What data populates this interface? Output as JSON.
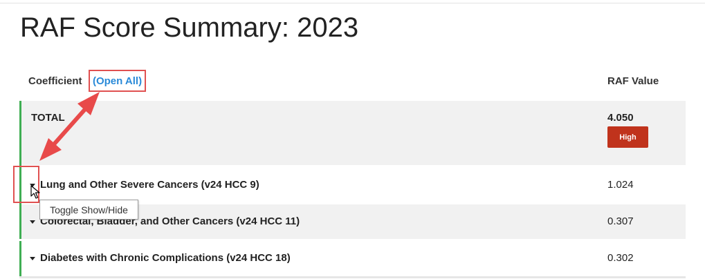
{
  "page": {
    "title": "RAF Score Summary: 2023"
  },
  "table": {
    "header_coefficient": "Coefficient",
    "open_all_open_paren": "(",
    "open_all_label": "Open All",
    "open_all_close_paren": ")",
    "header_raf_value": "RAF Value"
  },
  "total": {
    "label": "TOTAL",
    "value": "4.050",
    "badge": "High",
    "badge_color": "#c0331c"
  },
  "rows": [
    {
      "label": "Lung and Other Severe Cancers (v24 HCC 9)",
      "value": "1.024"
    },
    {
      "label": "Colorectal, Bladder, and Other Cancers (v24 HCC 11)",
      "value": "0.307"
    },
    {
      "label": "Diabetes with Chronic Complications (v24 HCC 18)",
      "value": "0.302"
    }
  ],
  "tooltip": {
    "text": "Toggle Show/Hide"
  },
  "colors": {
    "accent_border": "#3fae53",
    "link": "#2a8ad8",
    "annotation": "#e05050"
  }
}
